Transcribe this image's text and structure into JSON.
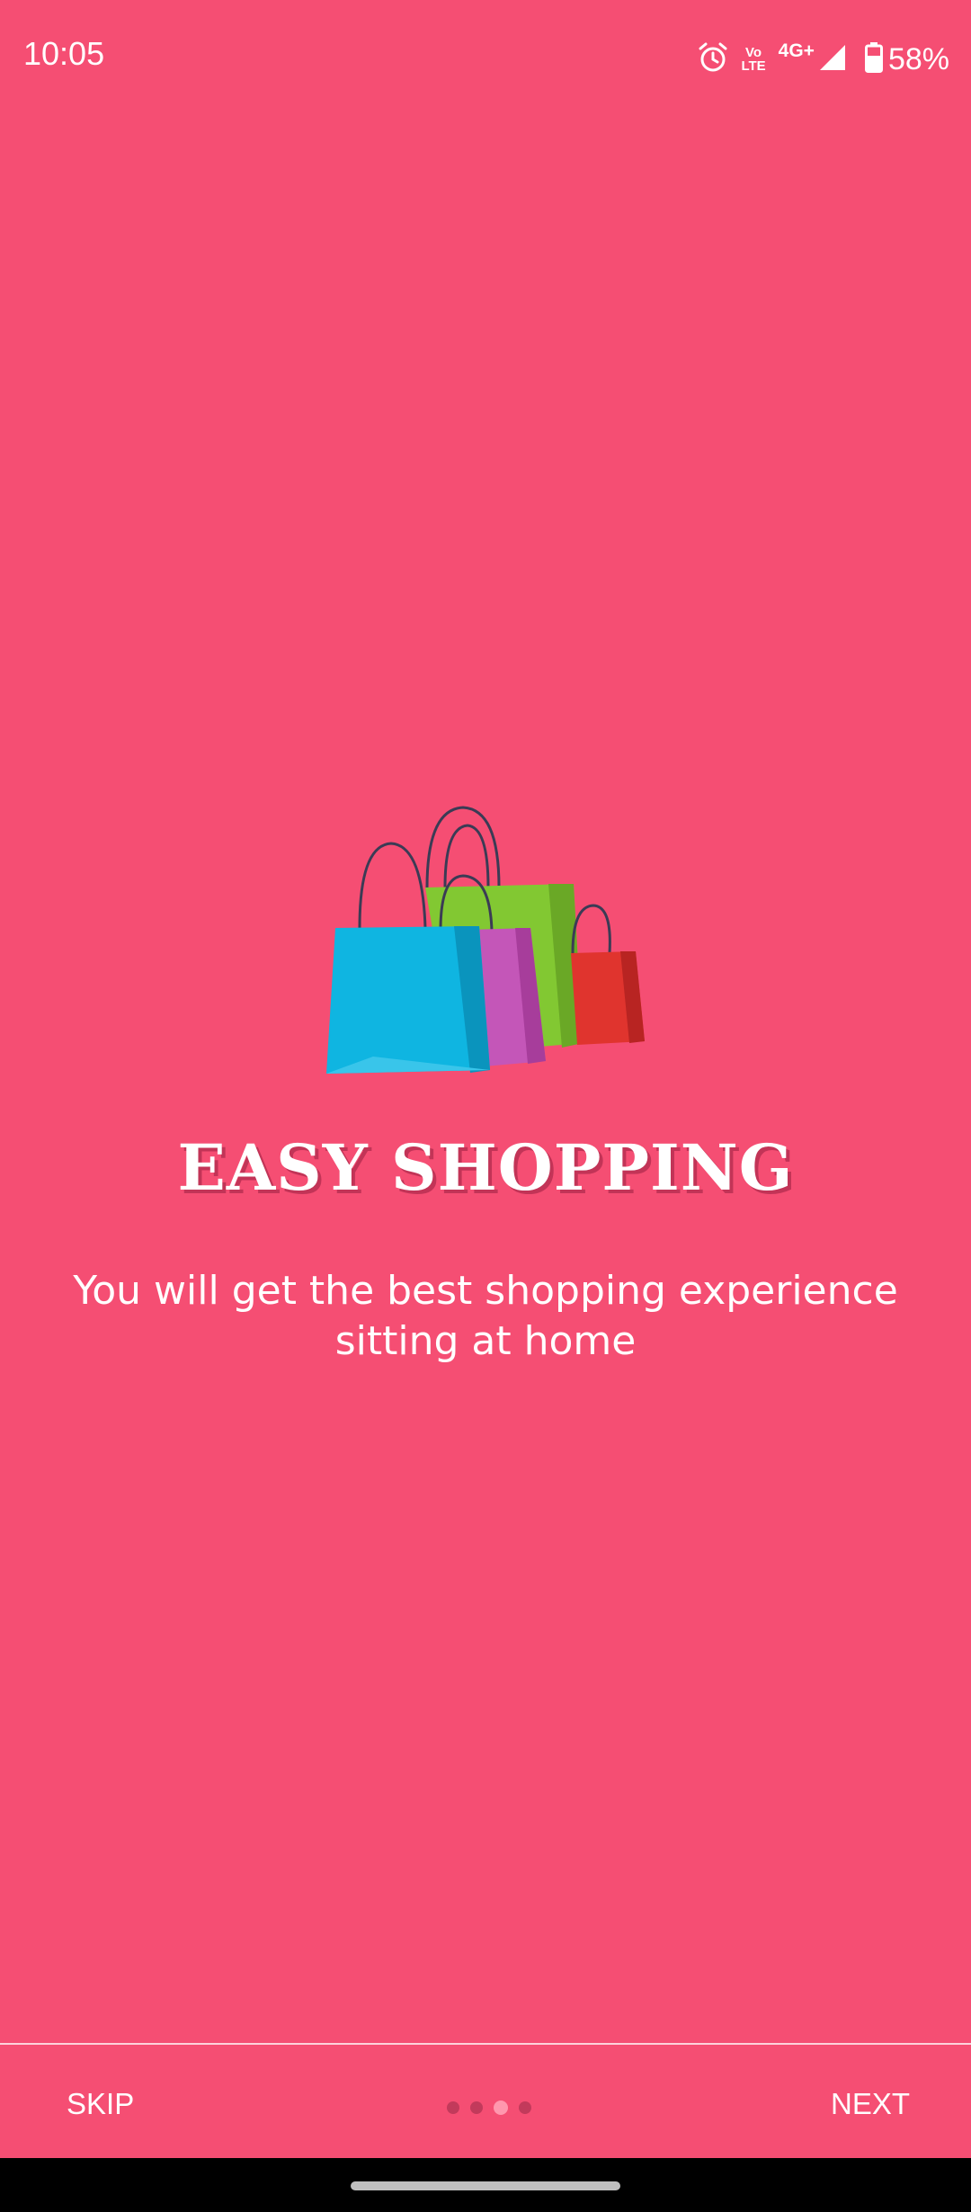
{
  "status_bar": {
    "time": "10:05",
    "icons": [
      "alarm-icon",
      "volte-icon",
      "4g-icon",
      "signal-icon",
      "battery-icon"
    ],
    "volte_top": "Vo",
    "volte_bottom": "LTE",
    "network": "4G+",
    "battery": "58%"
  },
  "onboarding": {
    "illustration": "shopping-bags",
    "title": "EASY SHOPPING",
    "description": "You will get the best shopping experience sitting at home",
    "page_count": 4,
    "active_page": 3
  },
  "bottom_bar": {
    "skip_label": "SKIP",
    "next_label": "NEXT"
  },
  "colors": {
    "background": "#f54e73",
    "dot_inactive": "#c23a5b",
    "dot_active": "#ff97ae",
    "text": "#ffffff"
  }
}
